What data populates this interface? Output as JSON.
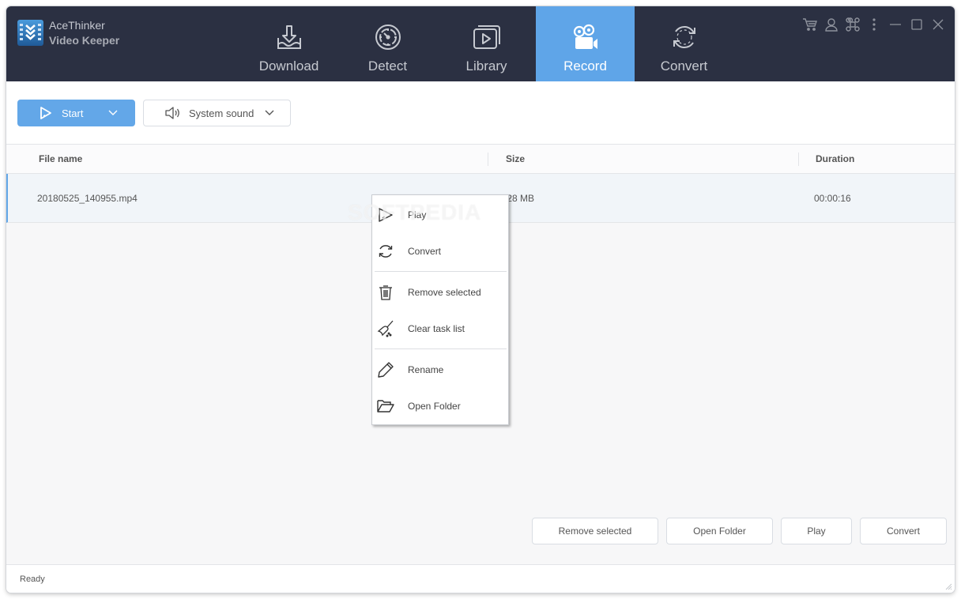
{
  "app": {
    "brand_line1": "AceThinker",
    "brand_line2": "Video Keeper",
    "accent_color": "#5fa5e8",
    "header_color": "#2b3042"
  },
  "nav": {
    "items": [
      {
        "label": "Download",
        "icon": "download-icon",
        "active": false
      },
      {
        "label": "Detect",
        "icon": "detect-icon",
        "active": false
      },
      {
        "label": "Library",
        "icon": "library-icon",
        "active": false
      },
      {
        "label": "Record",
        "icon": "video-camera-icon",
        "active": true
      },
      {
        "label": "Convert",
        "icon": "convert-icon",
        "active": false
      }
    ]
  },
  "window_controls": [
    "cart-icon",
    "user-icon",
    "command-icon",
    "more-icon",
    "minimize-icon",
    "maximize-icon",
    "close-icon"
  ],
  "toolbar": {
    "start_label": "Start",
    "audio_source_label": "System sound"
  },
  "table": {
    "columns": [
      "File name",
      "Size",
      "Duration"
    ],
    "rows": [
      {
        "file_name": "20180525_140955.mp4",
        "size": ".28 MB",
        "duration": "00:00:16",
        "selected": true
      }
    ]
  },
  "context_menu": {
    "items": [
      {
        "label": "Play",
        "icon": "play-icon"
      },
      {
        "label": "Convert",
        "icon": "convert-icon"
      },
      {
        "label": "Remove selected",
        "icon": "trash-icon"
      },
      {
        "label": "Clear task list",
        "icon": "broom-icon"
      },
      {
        "label": "Rename",
        "icon": "pencil-icon"
      },
      {
        "label": "Open Folder",
        "icon": "folder-icon"
      }
    ]
  },
  "actions": {
    "remove_selected": "Remove selected",
    "open_folder": "Open Folder",
    "play": "Play",
    "convert": "Convert"
  },
  "status": {
    "text": "Ready"
  },
  "watermark": "SOFTPEDIA"
}
